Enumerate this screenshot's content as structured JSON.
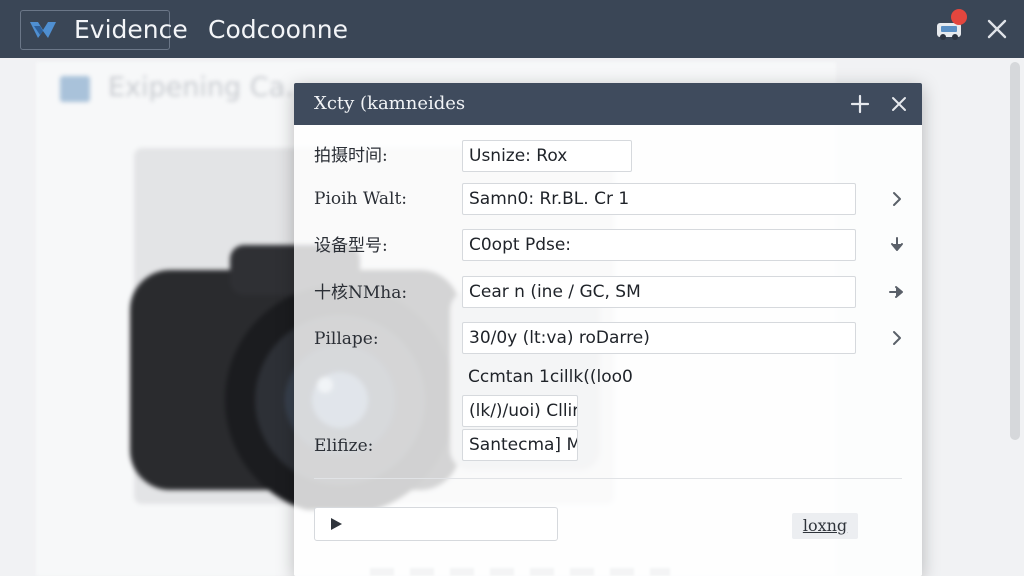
{
  "topbar": {
    "brand": "Evidence",
    "app_title": "Codcoonne",
    "colors": {
      "bar": "#3a4656",
      "badge": "#e2463e"
    },
    "icons": [
      "brand-logo-icon",
      "notification-icon",
      "close-icon"
    ]
  },
  "background": {
    "heading": "Exipening Ca..."
  },
  "dialog": {
    "title": "Xcty (kamneides",
    "icons": [
      "add-icon",
      "close-icon"
    ],
    "fields": [
      {
        "label": "拍摄时间:",
        "value": "Usnize: Rox"
      },
      {
        "label": "Pioih Walt:",
        "value": "Samn0: Rr.BL. Cr 1",
        "action_icon": "chevron-right-icon"
      },
      {
        "label": "设备型号:",
        "value": "C0opt Pdse:",
        "action_icon": "arrow-down-icon"
      },
      {
        "label": "十核NMha:",
        "value": "Cear n (ine / GC, SM",
        "action_icon": "arrow-right-icon"
      },
      {
        "label": "Pillape:",
        "value": "30/0y (lt:va) roDarre)",
        "action_icon": "chevron-right-icon"
      },
      {
        "label": "",
        "value": "Ccmtan 1cillk((loo0"
      },
      {
        "label": "",
        "value": "(lk/)/uoi) Cllire"
      },
      {
        "label": "Elifize:",
        "value": "Santecma] M"
      }
    ],
    "footer": {
      "play_icon": "play-icon",
      "log_label": "loxng"
    }
  }
}
